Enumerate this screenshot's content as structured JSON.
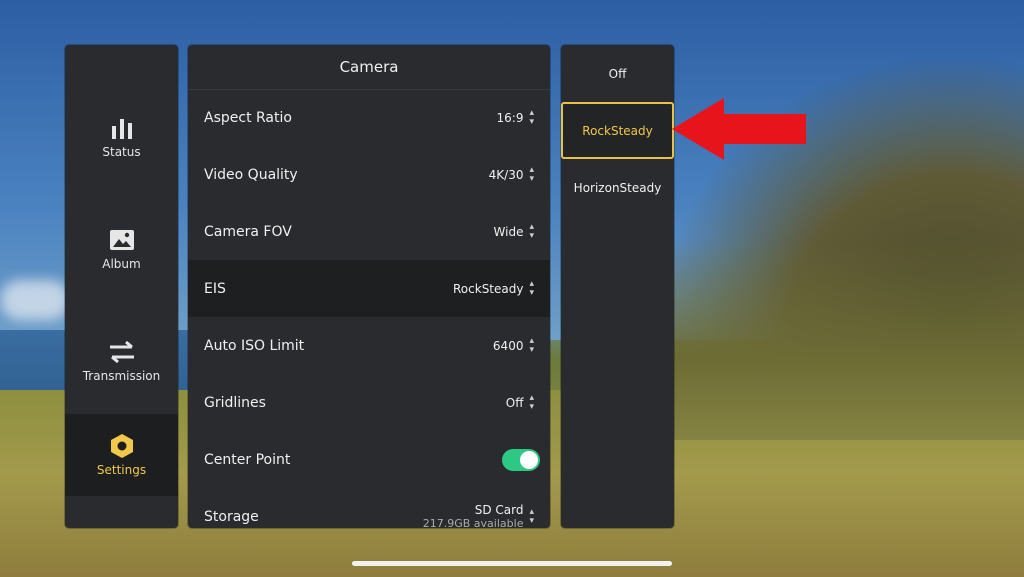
{
  "nav": {
    "items": [
      {
        "label": "Status",
        "icon": "bar-chart-icon",
        "active": false
      },
      {
        "label": "Album",
        "icon": "image-icon",
        "active": false
      },
      {
        "label": "Transmission",
        "icon": "transfer-arrows-icon",
        "active": false
      },
      {
        "label": "Settings",
        "icon": "hexagon-settings-icon",
        "active": true
      }
    ]
  },
  "camera": {
    "title": "Camera",
    "rows": [
      {
        "label": "Aspect Ratio",
        "value": "16:9"
      },
      {
        "label": "Video Quality",
        "value": "4K/30"
      },
      {
        "label": "Camera FOV",
        "value": "Wide"
      },
      {
        "label": "EIS",
        "value": "RockSteady"
      },
      {
        "label": "Auto ISO Limit",
        "value": "6400"
      },
      {
        "label": "Gridlines",
        "value": "Off"
      },
      {
        "label": "Center Point",
        "toggle_on": true
      },
      {
        "label": "Storage",
        "value": "SD Card",
        "subvalue": "217.9GB available"
      }
    ]
  },
  "options": {
    "items": [
      {
        "label": "Off"
      },
      {
        "label": "RockSteady"
      },
      {
        "label": "HorizonSteady"
      }
    ],
    "selected_index": 1
  },
  "colors": {
    "accent": "#f2c84b",
    "toggle_on": "#2ec885",
    "arrow": "#e8141c",
    "panel": "#2a2b2e"
  }
}
